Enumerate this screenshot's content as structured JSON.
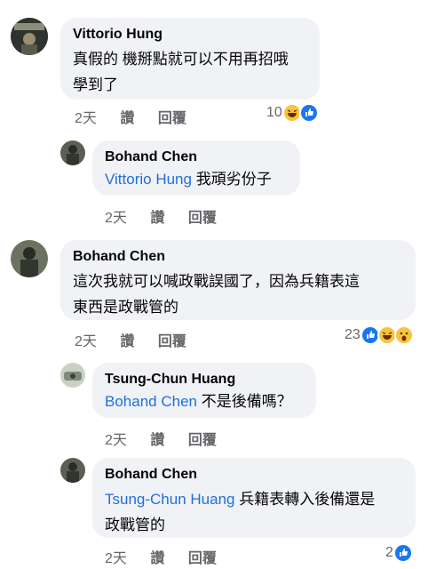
{
  "comments": [
    {
      "author": "Vittorio Hung",
      "text_line1": "真假的 機掰點就可以不用再招哦",
      "text_line2": "學到了",
      "time": "2天",
      "like_label": "讚",
      "reply_label": "回覆",
      "reaction_count": "10",
      "reactions": [
        "laugh-emoji-icon",
        "like-reaction-icon"
      ]
    },
    {
      "author": "Bohand Chen",
      "mention": "Vittorio Hung",
      "text": "我頑劣份子",
      "time": "2天",
      "like_label": "讚",
      "reply_label": "回覆"
    },
    {
      "author": "Bohand Chen",
      "text_line1": "這次我就可以喊政戰誤國了，因為兵籍表這",
      "text_line2": "東西是政戰管的",
      "time": "2天",
      "like_label": "讚",
      "reply_label": "回覆",
      "reaction_count": "23",
      "reactions": [
        "like-reaction-icon",
        "laugh-emoji-icon",
        "wow-emoji-icon"
      ]
    },
    {
      "author": "Tsung-Chun Huang",
      "mention": "Bohand Chen",
      "text": "不是後備嗎？",
      "time": "2天",
      "like_label": "讚",
      "reply_label": "回覆"
    },
    {
      "author": "Bohand Chen",
      "mention": "Tsung-Chun Huang",
      "text_line1": "兵籍表轉入後備還是",
      "text_line2": "政戰管的",
      "time": "2天",
      "like_label": "讚",
      "reply_label": "回覆",
      "reaction_count": "2",
      "reactions": [
        "like-reaction-icon"
      ]
    }
  ],
  "colors": {
    "bubble": "#f0f2f5",
    "mention": "#216fdb",
    "meta": "#65676b",
    "like_blue": "#1877f2"
  }
}
